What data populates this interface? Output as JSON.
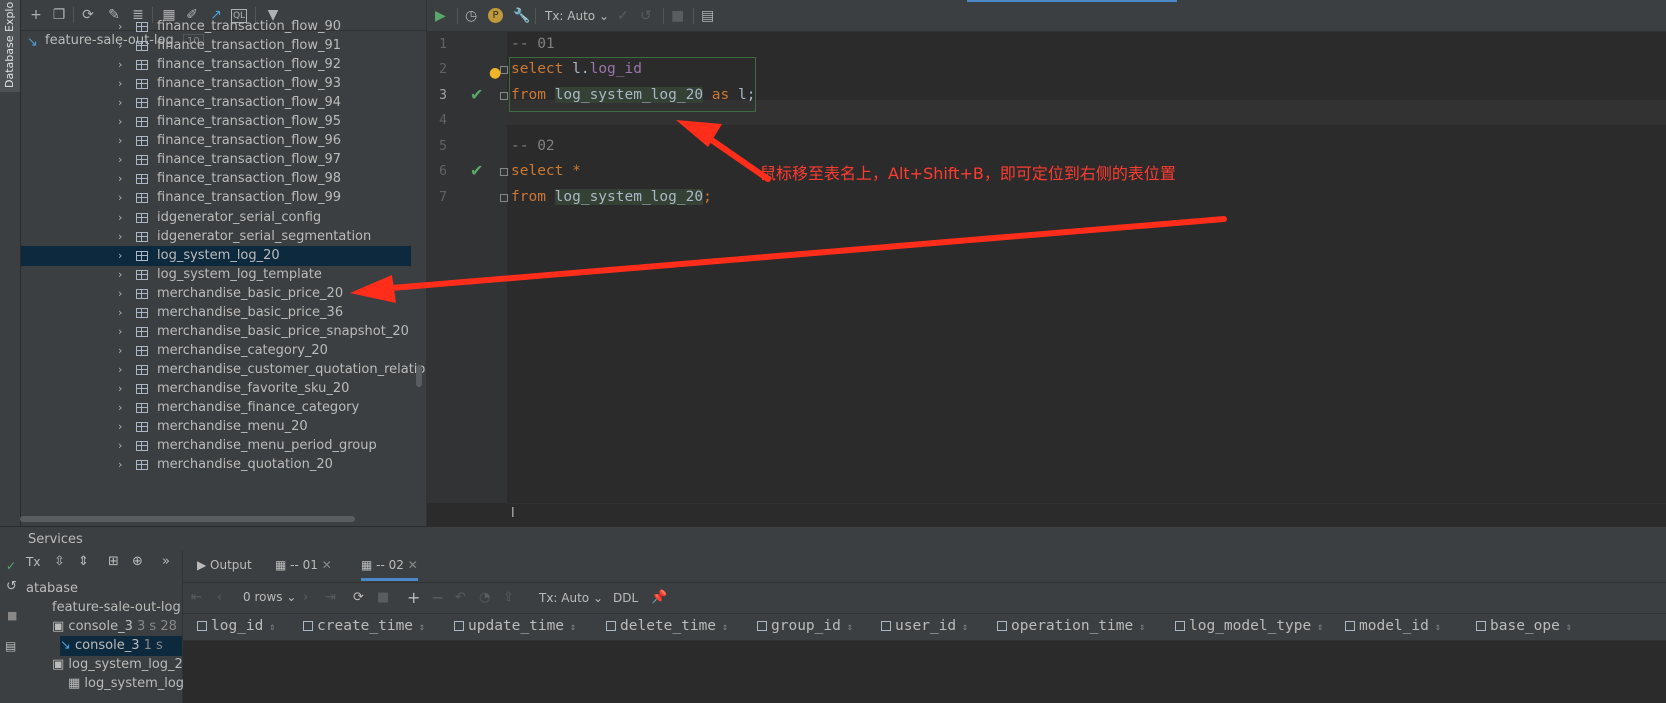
{
  "sidebar_tab": "Database Explo",
  "db_toolbar_icons": [
    "add-icon",
    "copy-icon",
    "refresh-icon",
    "edit-datasource-icon",
    "schema-icon",
    "table-icon",
    "edit-icon",
    "jump-to-icon",
    "sql-console-icon",
    "filter-icon"
  ],
  "tree": {
    "root_label": "feature-sale-out-log",
    "root_count": "10",
    "items": [
      "finance_transaction_flow_90",
      "finance_transaction_flow_91",
      "finance_transaction_flow_92",
      "finance_transaction_flow_93",
      "finance_transaction_flow_94",
      "finance_transaction_flow_95",
      "finance_transaction_flow_96",
      "finance_transaction_flow_97",
      "finance_transaction_flow_98",
      "finance_transaction_flow_99",
      "idgenerator_serial_config",
      "idgenerator_serial_segmentation",
      "log_system_log_20",
      "log_system_log_template",
      "merchandise_basic_price_20",
      "merchandise_basic_price_36",
      "merchandise_basic_price_snapshot_20",
      "merchandise_category_20",
      "merchandise_customer_quotation_relatio",
      "merchandise_favorite_sku_20",
      "merchandise_finance_category",
      "merchandise_menu_20",
      "merchandise_menu_period_group",
      "merchandise_quotation_20"
    ],
    "selected_index": 12
  },
  "editor": {
    "toolbar": {
      "tx_label": "Tx: Auto"
    },
    "line_numbers": [
      "1",
      "2",
      "3",
      "4",
      "5",
      "6",
      "7"
    ],
    "current_line": "3",
    "code": {
      "l1": "-- 01",
      "l2_kw": "select",
      "l2_alias": "l.",
      "l2_field": "log_id",
      "l3_kw": "from",
      "l3_table": "log_system_log_20",
      "l3_as": "as",
      "l3_alias": "l;",
      "l5": "-- 02",
      "l6_kw": "select",
      "l6_star": "*",
      "l7_kw": "from",
      "l7_table": "log_system_log_20",
      "l7_end": ";"
    },
    "annotation": "鼠标移至表名上，Alt+Shift+B，即可定位到右侧的表位置",
    "bottom_text": "l"
  },
  "services": {
    "title": "Services",
    "tree": [
      {
        "label": "atabase",
        "time": ""
      },
      {
        "label": "feature-sale-out-log",
        "time": ""
      },
      {
        "label": "console_3",
        "time": "3 s 28"
      },
      {
        "label": "console_3",
        "time": "1 s"
      },
      {
        "label": "log_system_log_2",
        "time": ""
      },
      {
        "label": "log_system_log",
        "time": ""
      }
    ],
    "tx_short": "Tx",
    "tabs": {
      "output": "Output",
      "tab1": "-- 01",
      "tab2": "-- 02"
    },
    "result_toolbar": {
      "rows": "0 rows",
      "tx": "Tx: Auto",
      "ddl": "DDL"
    },
    "columns": [
      "log_id",
      "create_time",
      "update_time",
      "delete_time",
      "group_id",
      "user_id",
      "operation_time",
      "log_model_type",
      "model_id",
      "base_ope"
    ]
  },
  "colors": {
    "accent": "#4a88c7",
    "selection": "#0d293e",
    "annotation": "#ff3b30",
    "keyword": "#cc7832",
    "field": "#9876aa",
    "check": "#59a869"
  }
}
